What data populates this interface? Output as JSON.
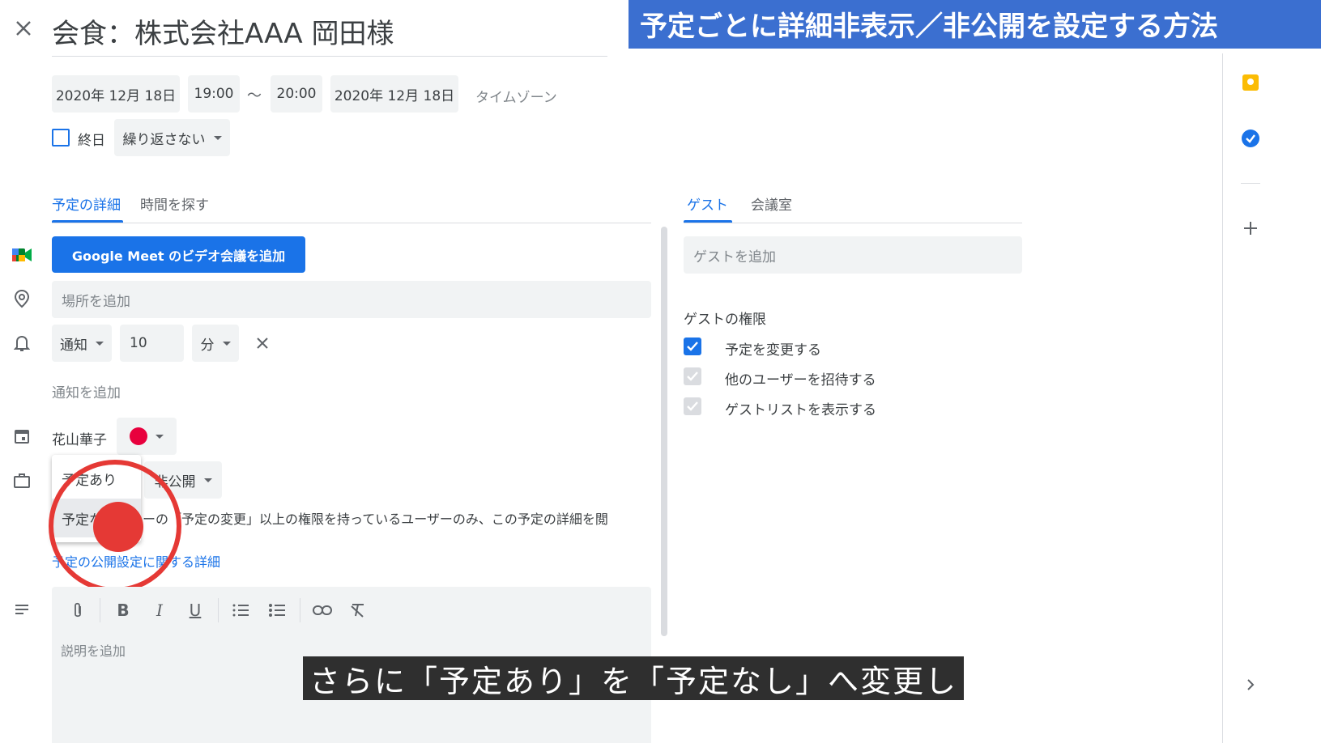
{
  "event": {
    "title": "会食：株式会社AAA 岡田様",
    "start_date": "2020年 12月 18日",
    "start_time": "19:00",
    "range_separator": "〜",
    "end_time": "20:00",
    "end_date": "2020年 12月 18日",
    "timezone_label": "タイムゾーン",
    "all_day_label": "終日",
    "repeat_label": "繰り返さない"
  },
  "left_tabs": [
    {
      "label": "予定の詳細",
      "active": true
    },
    {
      "label": "時間を探す",
      "active": false
    }
  ],
  "details": {
    "meet_button": "Google Meet のビデオ会議を追加",
    "location_placeholder": "場所を追加",
    "notification_type": "通知",
    "notification_value": "10",
    "notification_unit": "分",
    "add_notification": "通知を追加",
    "calendar_owner": "花山華子",
    "calendar_color": "#e8003d",
    "visibility_value": "非公開",
    "visibility_info": "ーの「予定の変更」以上の権限を持っているユーザーのみ、この予定の詳細を閲",
    "visibility_link": "予定の公開設定に関する詳細",
    "description_placeholder": "説明を追加"
  },
  "availability_menu": {
    "options": [
      "予定あり",
      "予定なし"
    ],
    "hovered": "予定なし"
  },
  "right_tabs": [
    {
      "label": "ゲスト",
      "active": true
    },
    {
      "label": "会議室",
      "active": false
    }
  ],
  "guests": {
    "add_placeholder": "ゲストを追加",
    "permissions_heading": "ゲストの権限",
    "permissions": [
      {
        "label": "予定を変更する",
        "checked": true,
        "enabled": true
      },
      {
        "label": "他のユーザーを招待する",
        "checked": true,
        "enabled": false
      },
      {
        "label": "ゲストリストを表示する",
        "checked": true,
        "enabled": false
      }
    ]
  },
  "overlay": {
    "banner": "予定ごとに詳細非表示／非公開を設定する方法",
    "subtitle": "さらに「予定あり」を「予定なし」へ変更し"
  },
  "colors": {
    "accent": "#1a73e8",
    "banner_bg": "#3b6fd0",
    "annotation_red": "#e53935"
  }
}
